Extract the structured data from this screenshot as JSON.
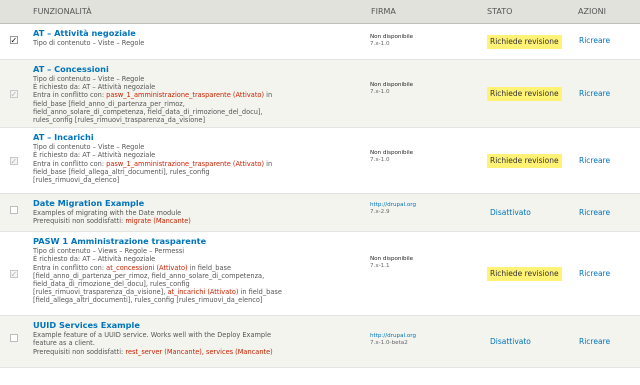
{
  "columns": {
    "feature": "FUNZIONALITÀ",
    "signature": "FIRMA",
    "state": "STATO",
    "actions": "AZIONI"
  },
  "rows": [
    {
      "checkbox": "checked",
      "title": "AT – Attività negoziale",
      "lines": [
        [
          {
            "t": "Tipo di contenuto – Viste – Regole"
          }
        ]
      ],
      "signature": "Non disponibile",
      "version": "7.x-1.0",
      "state": "Richiede revisione",
      "state_kind": "warn",
      "action": "Ricreare"
    },
    {
      "checkbox": "disabled",
      "title": "AT – Concessioni",
      "lines": [
        [
          {
            "t": "Tipo di contenuto – Viste – Regole"
          }
        ],
        [
          {
            "t": "È richiesto da: AT – Attività negoziale"
          }
        ],
        [
          {
            "t": "Entra in conflitto con: "
          },
          {
            "t": "pasw_1_amministrazione_trasparente (Attivato)",
            "red": true
          },
          {
            "t": " in"
          }
        ],
        [
          {
            "t": "field_base [field_anno_di_partenza_per_rimoz,"
          }
        ],
        [
          {
            "t": "field_anno_solare_di_competenza, field_data_di_rimozione_del_docu],"
          }
        ],
        [
          {
            "t": "rules_config [rules_rimuovi_trasparenza_da_visione]"
          }
        ]
      ],
      "signature": "Non disponibile",
      "version": "7.x-1.0",
      "state": "Richiede revisione",
      "state_kind": "warn",
      "action": "Ricreare"
    },
    {
      "checkbox": "disabled",
      "title": "AT – Incarichi",
      "lines": [
        [
          {
            "t": "Tipo di contenuto – Viste – Regole"
          }
        ],
        [
          {
            "t": "È richiesto da: AT – Attività negoziale"
          }
        ],
        [
          {
            "t": "Entra in conflitto con: "
          },
          {
            "t": "pasw_1_amministrazione_trasparente (Attivato)",
            "red": true
          },
          {
            "t": " in"
          }
        ],
        [
          {
            "t": "field_base [field_allega_altri_documenti], rules_config"
          }
        ],
        [
          {
            "t": "[rules_rimuovi_da_elenco]"
          }
        ]
      ],
      "signature": "Non disponibile",
      "version": "7.x-1.0",
      "state": "Richiede revisione",
      "state_kind": "warn",
      "action": "Ricreare"
    },
    {
      "checkbox": "unchecked",
      "title": "Date Migration Example",
      "lines": [
        [
          {
            "t": "Examples of migrating with the Date module"
          }
        ],
        [
          {
            "t": "Prerequisiti non soddisfatti: "
          },
          {
            "t": "migrate (Mancante)",
            "red": true
          }
        ]
      ],
      "signature": "http://drupal.org",
      "version": "7.x-2.9",
      "state": "Disattivato",
      "state_kind": "off",
      "action": "Ricreare"
    },
    {
      "checkbox": "disabled",
      "title": "PASW 1 Amministrazione trasparente",
      "lines": [
        [
          {
            "t": "Tipo di contenuto – Views – Regole – Permessi"
          }
        ],
        [
          {
            "t": "È richiesto da: AT – Attività negoziale"
          }
        ],
        [
          {
            "t": "Entra in conflitto con: "
          },
          {
            "t": "at_concessioni (Attivato)",
            "red": true
          },
          {
            "t": " in field_base"
          }
        ],
        [
          {
            "t": "[field_anno_di_partenza_per_rimoz, field_anno_solare_di_competenza,"
          }
        ],
        [
          {
            "t": "field_data_di_rimozione_del_docu], rules_config"
          }
        ],
        [
          {
            "t": "[rules_rimuovi_trasparenza_da_visione], "
          },
          {
            "t": "at_incarichi (Attivato)",
            "red": true
          },
          {
            "t": " in field_base"
          }
        ],
        [
          {
            "t": "[field_allega_altri_documenti], rules_config [rules_rimuovi_da_elenco]"
          }
        ]
      ],
      "signature": "Non disponibile",
      "version": "7.x-1.1",
      "state": "Richiede revisione",
      "state_kind": "warn",
      "action": "Ricreare"
    },
    {
      "checkbox": "unchecked",
      "title": "UUID Services Example",
      "lines": [
        [
          {
            "t": "Example feature of a UUID service. Works well with the Deploy Example"
          }
        ],
        [
          {
            "t": "feature as a client."
          }
        ],
        [
          {
            "t": "Prerequisiti non soddisfatti: "
          },
          {
            "t": "rest_server (Mancante), services (Mancante)",
            "red": true
          }
        ]
      ],
      "signature": "http://drupal.org",
      "version": "7.x-1.0-beta2",
      "state": "Disattivato",
      "state_kind": "off",
      "action": "Ricreare"
    }
  ]
}
